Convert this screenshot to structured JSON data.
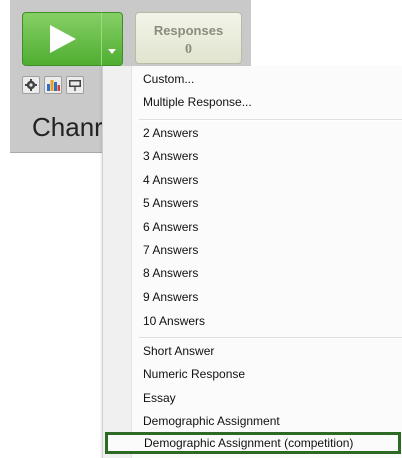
{
  "toolbar": {
    "responses_label": "Responses",
    "responses_count": "0",
    "channel_text": "Chanr",
    "icons": [
      "gear-icon",
      "bar-chart-icon",
      "presentation-icon"
    ]
  },
  "menu": {
    "items": [
      "Custom...",
      "Multiple Response...",
      "2 Answers",
      "3 Answers",
      "4 Answers",
      "5 Answers",
      "6 Answers",
      "7 Answers",
      "8 Answers",
      "9 Answers",
      "10 Answers",
      "Short Answer",
      "Numeric Response",
      "Essay",
      "Demographic Assignment",
      "Demographic Assignment (competition)"
    ]
  },
  "colors": {
    "play_green": "#4fae31",
    "highlight_border": "#2d6b25"
  }
}
